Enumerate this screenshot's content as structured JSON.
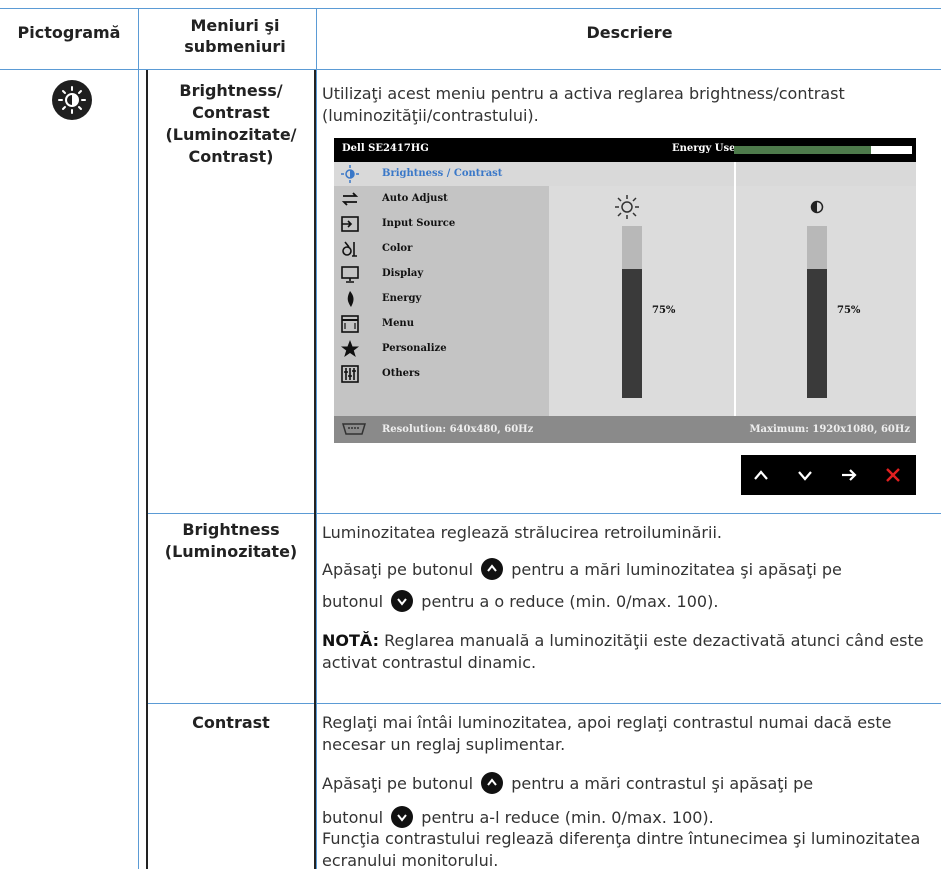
{
  "headers": {
    "icon_col": "Pictogramă",
    "menu_col": "Meniuri şi submeniuri",
    "desc_col": "Descriere"
  },
  "row1": {
    "title": "Brightness/ Contrast (Luminozitate/ Contrast)",
    "desc": "Utilizaţi acest meniu pentru a activa reglarea brightness/contrast (luminozităţii/contrastului)."
  },
  "osd": {
    "model": "Dell SE2417HG",
    "energy_label": "Energy Use",
    "energy_level": 0.77,
    "menu_items": [
      {
        "label": "Brightness / Contrast",
        "icon": "brightness-icon"
      },
      {
        "label": "Auto Adjust",
        "icon": "auto-adjust-icon"
      },
      {
        "label": "Input Source",
        "icon": "input-source-icon"
      },
      {
        "label": "Color",
        "icon": "color-icon"
      },
      {
        "label": "Display",
        "icon": "display-icon"
      },
      {
        "label": "Energy",
        "icon": "energy-icon"
      },
      {
        "label": "Menu",
        "icon": "menu-icon"
      },
      {
        "label": "Personalize",
        "icon": "star-icon"
      },
      {
        "label": "Others",
        "icon": "sliders-icon"
      }
    ],
    "brightness_value": "75%",
    "brightness_level": 0.75,
    "contrast_value": "75%",
    "contrast_level": 0.75,
    "resolution": "Resolution: 640x480, 60Hz",
    "maximum": "Maximum: 1920x1080, 60Hz",
    "colors": {
      "accent": "#3a78c8",
      "energy": "#4e7a4b",
      "close": "#e02020"
    }
  },
  "row2": {
    "title": "Brightness (Luminozitate)",
    "p1": "Luminozitatea reglează strălucirea retroiluminării.",
    "p2a": "Apăsaţi pe butonul",
    "p2b": "pentru a mări luminozitatea şi apăsaţi pe",
    "p2c": "butonul",
    "p2d": "pentru a o reduce (min. 0/max. 100).",
    "note_label": "NOTĂ:",
    "note_text": " Reglarea manuală a luminozităţii este dezactivată atunci când este activat contrastul dinamic."
  },
  "row3": {
    "title": "Contrast",
    "p1": "Reglaţi mai întâi luminozitatea, apoi reglaţi contrastul numai dacă este necesar un reglaj suplimentar.",
    "p2a": "Apăsaţi pe butonul",
    "p2b": "pentru a mări contrastul şi apăsaţi pe",
    "p2c": "butonul",
    "p2d": "pentru a-l reduce (min. 0/max. 100).",
    "p3": "Funcţia contrastului reglează diferenţa dintre întunecimea şi luminozitatea ecranului monitorului."
  }
}
